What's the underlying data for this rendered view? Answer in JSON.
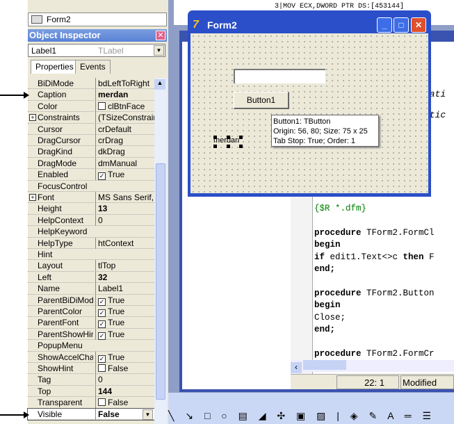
{
  "tree": {
    "item": "Form2"
  },
  "inspector": {
    "title": "Object Inspector",
    "component": "Label1",
    "component_type": "TLabel",
    "tabs": [
      "Properties",
      "Events"
    ],
    "properties": [
      {
        "name": "BiDiMode",
        "value": "bdLeftToRight"
      },
      {
        "name": "Caption",
        "value": "merdan",
        "bold": true
      },
      {
        "name": "Color",
        "value": "clBtnFace",
        "swatch": true
      },
      {
        "name": "Constraints",
        "value": "(TSizeConstrain",
        "expand": true
      },
      {
        "name": "Cursor",
        "value": "crDefault"
      },
      {
        "name": "DragCursor",
        "value": "crDrag"
      },
      {
        "name": "DragKind",
        "value": "dkDrag"
      },
      {
        "name": "DragMode",
        "value": "dmManual"
      },
      {
        "name": "Enabled",
        "value": "True",
        "check": true
      },
      {
        "name": "FocusControl",
        "value": ""
      },
      {
        "name": "Font",
        "value": "MS Sans Serif, 8",
        "expand": true
      },
      {
        "name": "Height",
        "value": "13",
        "bold": true
      },
      {
        "name": "HelpContext",
        "value": "0"
      },
      {
        "name": "HelpKeyword",
        "value": ""
      },
      {
        "name": "HelpType",
        "value": "htContext"
      },
      {
        "name": "Hint",
        "value": ""
      },
      {
        "name": "Layout",
        "value": "tlTop"
      },
      {
        "name": "Left",
        "value": "32",
        "bold": true
      },
      {
        "name": "Name",
        "value": "Label1"
      },
      {
        "name": "ParentBiDiMode",
        "value": "True",
        "check": true
      },
      {
        "name": "ParentColor",
        "value": "True",
        "check": true
      },
      {
        "name": "ParentFont",
        "value": "True",
        "check": true
      },
      {
        "name": "ParentShowHint",
        "value": "True",
        "check": true
      },
      {
        "name": "PopupMenu",
        "value": ""
      },
      {
        "name": "ShowAccelChar",
        "value": "True",
        "check": true
      },
      {
        "name": "ShowHint",
        "value": "False",
        "check": false
      },
      {
        "name": "Tag",
        "value": "0"
      },
      {
        "name": "Top",
        "value": "144",
        "bold": true
      },
      {
        "name": "Transparent",
        "value": "False",
        "check": false
      },
      {
        "name": "Visible",
        "value": "False",
        "bold": true,
        "selected": true
      }
    ]
  },
  "asm": "3|MOV ECX,DWORD PTR DS:[453144]",
  "form": {
    "title": "Form2",
    "button": "Button1",
    "label": "merdan",
    "hint": [
      "Button1: TButton",
      "Origin: 56, 80; Size: 75 x 25",
      "Tab Stop: True; Order: 1"
    ]
  },
  "editor": {
    "side_code": [
      "rati",
      "atic"
    ],
    "lines": [
      {
        "t": "{$R *.dfm}",
        "c": "cm"
      },
      {
        "t": ""
      },
      {
        "t": "procedure TForm2.FormCl",
        "k": "procedure"
      },
      {
        "t": "begin",
        "k": "begin"
      },
      {
        "t": "if edit1.Text<>c then F",
        "k": "if"
      },
      {
        "t": "end;",
        "k": "end;"
      },
      {
        "t": ""
      },
      {
        "t": "procedure TForm2.Button",
        "k": "procedure"
      },
      {
        "t": "begin",
        "k": "begin"
      },
      {
        "t": "Close;"
      },
      {
        "t": "end;",
        "k": "end;"
      },
      {
        "t": ""
      },
      {
        "t": "procedure TForm2.FormCr",
        "k": "procedure"
      }
    ],
    "position": "22:  1",
    "state": "Modified"
  }
}
